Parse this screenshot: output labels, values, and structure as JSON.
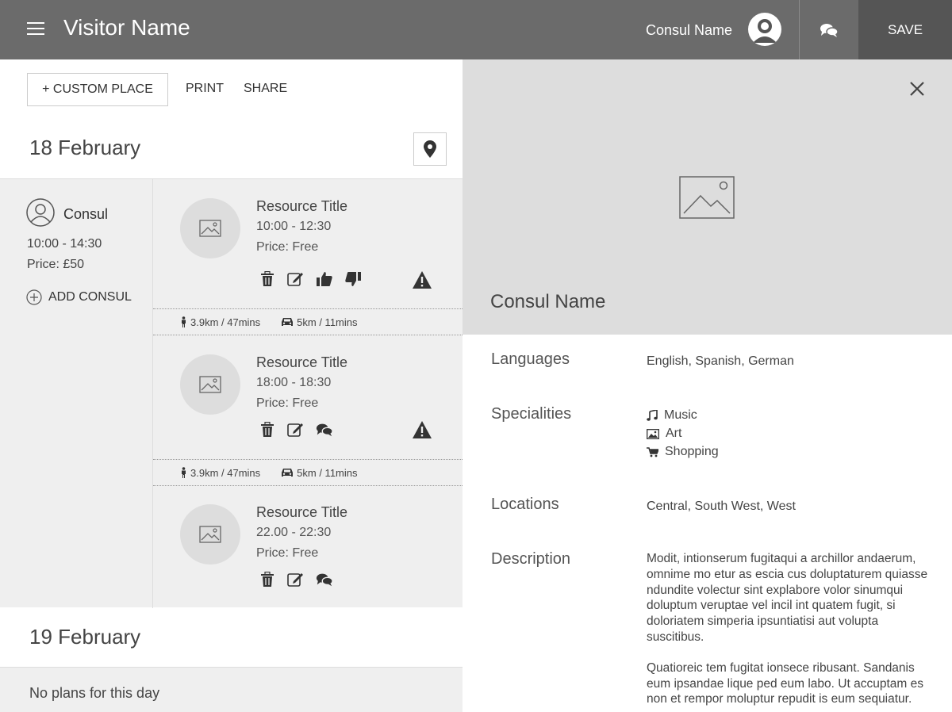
{
  "header": {
    "title": "Visitor Name",
    "consul_name": "Consul Name",
    "save_label": "SAVE"
  },
  "toolbar": {
    "custom_place_label": "+ CUSTOM PLACE",
    "print_label": "PRINT",
    "share_label": "SHARE"
  },
  "days": [
    {
      "title": "18 February",
      "consul": {
        "label": "Consul",
        "time": "10:00 - 14:30",
        "price": "Price: £50",
        "add_label": "ADD CONSUL"
      },
      "resources": [
        {
          "title": "Resource Title",
          "time": "10:00 - 12:30",
          "price": "Price: Free"
        },
        {
          "title": "Resource Title",
          "time": "18:00 - 18:30",
          "price": "Price: Free"
        },
        {
          "title": "Resource Title",
          "time": "22.00 - 22:30",
          "price": "Price: Free"
        }
      ],
      "travel": [
        {
          "walk": "3.9km / 47mins",
          "drive": "5km / 11mins"
        },
        {
          "walk": "3.9km / 47mins",
          "drive": "5km / 11mins"
        }
      ]
    },
    {
      "title": "19 February",
      "empty_text": "No plans for this day"
    }
  ],
  "panel": {
    "name": "Consul Name",
    "languages_label": "Languages",
    "languages_value": "English, Spanish, German",
    "specialities_label": "Specialities",
    "specialities": [
      "Music",
      "Art",
      "Shopping"
    ],
    "locations_label": "Locations",
    "locations_value": "Central, South West, West",
    "description_label": "Description",
    "description_p1": "Modit, intionserum fugitaqui a archillor andaerum, omnime mo etur as escia cus doluptaturem quiasse ndundite volectur sint explabore volor sinumqui doluptum veruptae vel incil int quatem fugit, si doloriatem simperia ipsuntiatisi aut volupta suscitibus.",
    "description_p2": "Quatioreic tem fugitat ionsece ribusant. Sandanis eum ipsandae lique ped eum labo. Ut accuptam es non et rempor moluptur repudit is eum sequiatur."
  }
}
